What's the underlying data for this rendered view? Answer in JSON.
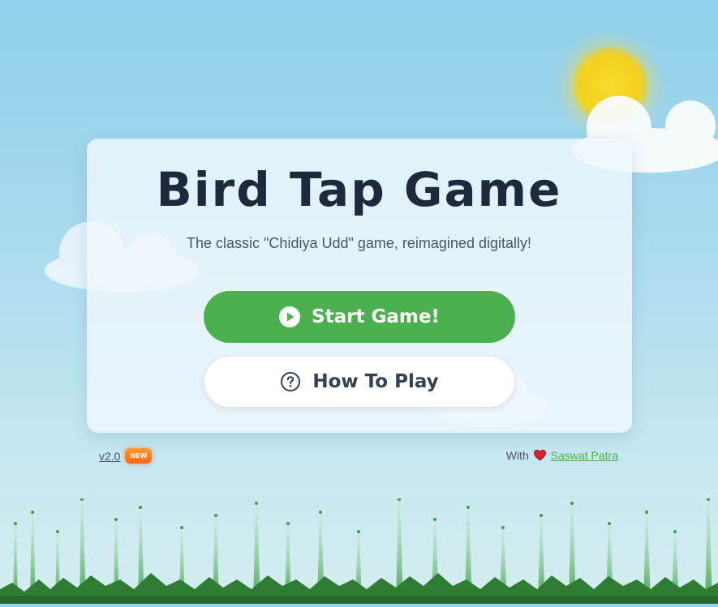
{
  "title": "Bird Tap Game",
  "subtitle": "The classic \"Chidiya Udd\" game, reimagined digitally!",
  "buttons": {
    "start_label": "Start Game!",
    "how_label": "How To Play"
  },
  "footer": {
    "version": "v2.0",
    "badge": "NEW",
    "with_text": "With",
    "author": "Saswat Patra"
  },
  "icons": {
    "start": "play-circle-icon",
    "how": "question-circle-icon",
    "heart": "heart-icon"
  },
  "colors": {
    "accent": "#4caf50",
    "title": "#1e293b",
    "badge": "#f26a1b",
    "heart": "#e11d2e"
  }
}
